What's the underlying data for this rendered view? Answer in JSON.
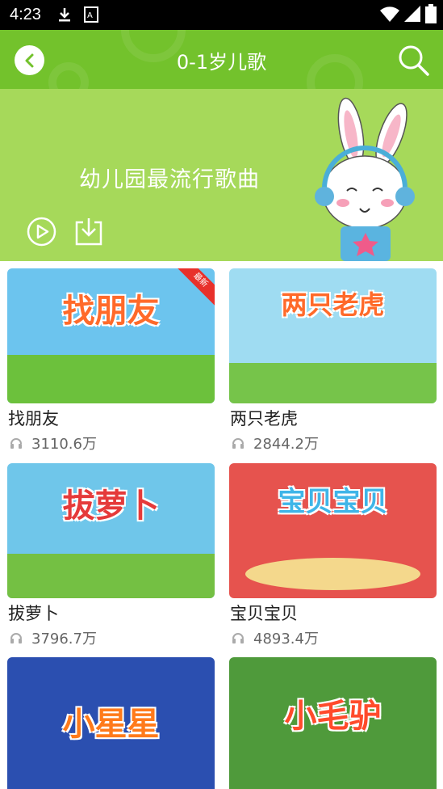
{
  "status_bar": {
    "time": "4:23"
  },
  "app_bar": {
    "title": "0-1岁儿歌"
  },
  "banner": {
    "title": "幼儿园最流行歌曲"
  },
  "badge_label": "最新",
  "songs": [
    {
      "title": "找朋友",
      "plays": "3110.6万",
      "thumb_text": "找朋友",
      "bg": "#6cc4ee",
      "is_new": true
    },
    {
      "title": "两只老虎",
      "plays": "2844.2万",
      "thumb_text": "两只老虎",
      "bg": "#9fdcf2"
    },
    {
      "title": "拔萝卜",
      "plays": "3796.7万",
      "thumb_text": "拔萝卜",
      "bg": "#6fc6ea"
    },
    {
      "title": "宝贝宝贝",
      "plays": "4893.4万",
      "thumb_text": "宝贝宝贝",
      "bg": "#e6534e"
    },
    {
      "title": "",
      "plays": "",
      "thumb_text": "小星星",
      "bg": "#2b4fb0"
    },
    {
      "title": "",
      "plays": "",
      "thumb_text": "小毛驴",
      "bg": "#4f9a3b"
    }
  ],
  "colors": {
    "app_bar": "#73c22c",
    "banner": "#a6d95a",
    "status_bar": "#000000"
  }
}
